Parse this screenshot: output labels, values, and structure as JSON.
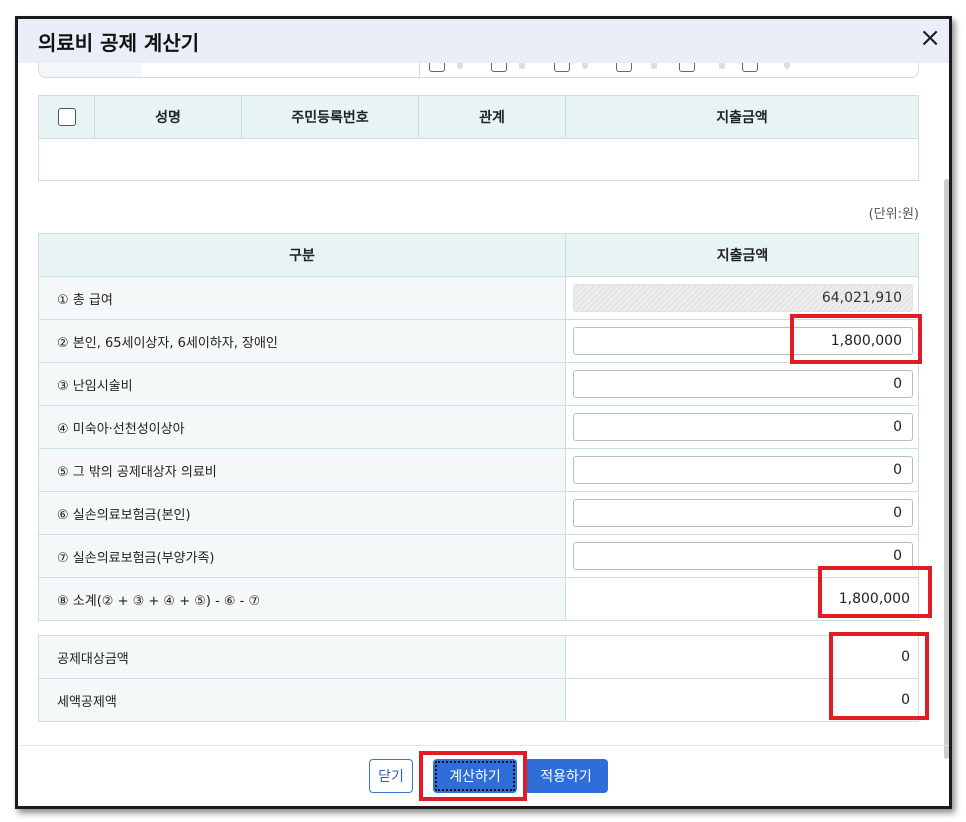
{
  "dialog": {
    "title": "의료비 공제 계산기",
    "close_icon": "×"
  },
  "top_table": {
    "headers": [
      "성명",
      "주민등록번호",
      "관계",
      "지출금액"
    ]
  },
  "unit_label": "(단위:원)",
  "main_table": {
    "headers": [
      "구분",
      "지출금액"
    ],
    "rows": [
      {
        "label": "① 총 급여",
        "value": "64,021,910"
      },
      {
        "label": "② 본인, 65세이상자, 6세이하자, 장애인",
        "value": "1,800,000"
      },
      {
        "label": "③ 난임시술비",
        "value": "0"
      },
      {
        "label": "④ 미숙아·선천성이상아",
        "value": "0"
      },
      {
        "label": "⑤ 그 밖의 공제대상자 의료비",
        "value": "0"
      },
      {
        "label": "⑥ 실손의료보험금(본인)",
        "value": "0"
      },
      {
        "label": "⑦ 실손의료보험금(부양가족)",
        "value": "0"
      },
      {
        "label": "⑧ 소계(② + ③ + ④ + ⑤) - ⑥ - ⑦",
        "value": "1,800,000"
      }
    ]
  },
  "summary_table": {
    "rows": [
      {
        "label": "공제대상금액",
        "value": "0"
      },
      {
        "label": "세액공제액",
        "value": "0"
      }
    ]
  },
  "buttons": {
    "close": "닫기",
    "calculate": "계산하기",
    "apply": "적용하기"
  },
  "colors": {
    "accent": "#2f6ed8",
    "highlight": "#e01c24",
    "header_bg": "#e8f4f4"
  }
}
